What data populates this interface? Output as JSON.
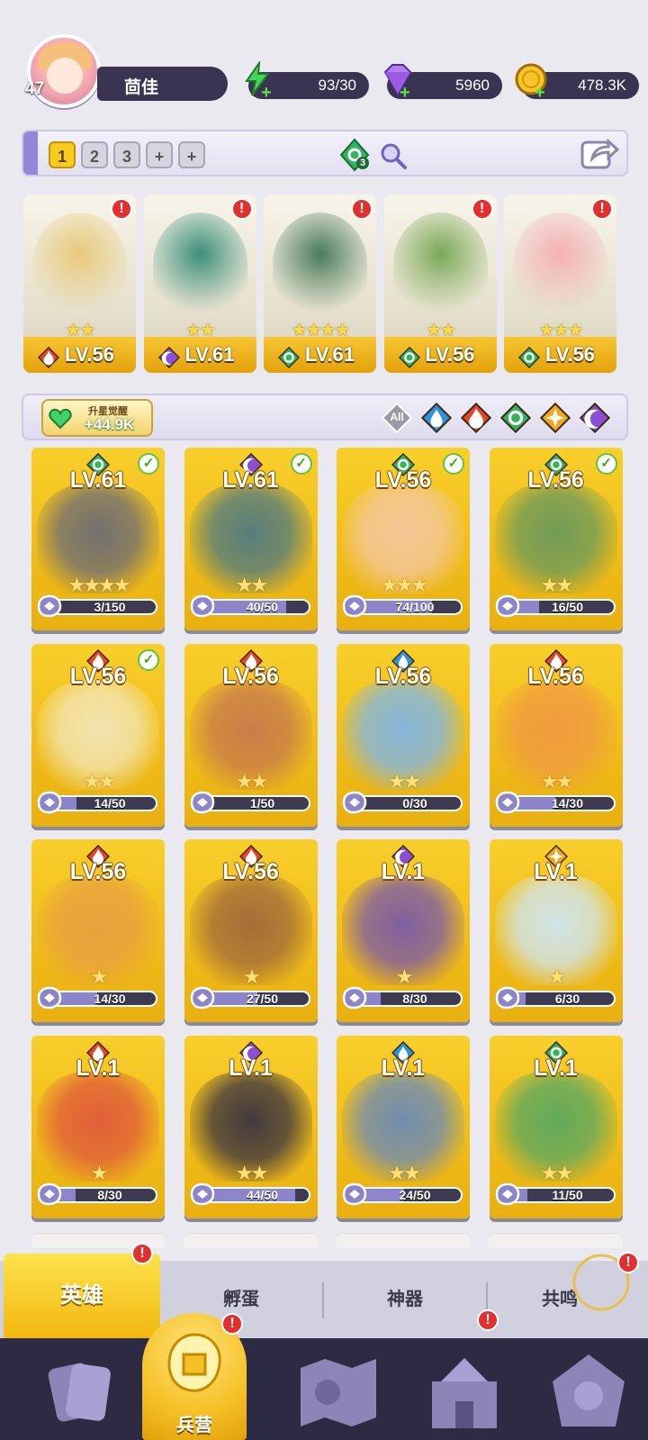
{
  "player": {
    "level": "47",
    "name": "茴佳"
  },
  "resources": {
    "energy": "93/30",
    "gems": "5960",
    "gold": "478.3K"
  },
  "team_bar": {
    "slots": [
      "1",
      "2",
      "3",
      "+",
      "+"
    ],
    "active_slot": "1",
    "badge_count": "3"
  },
  "team": [
    {
      "level": "LV.56",
      "element": "fire",
      "stars": "★★"
    },
    {
      "level": "LV.61",
      "element": "dark",
      "stars": "★★"
    },
    {
      "level": "LV.61",
      "element": "wind",
      "stars": "★★★★"
    },
    {
      "level": "LV.56",
      "element": "wind",
      "stars": "★★"
    },
    {
      "level": "LV.56",
      "element": "wind",
      "stars": "★★★"
    }
  ],
  "awaken": {
    "label": "升星觉醒",
    "value": "+44.9K"
  },
  "filters": {
    "all_label": "All",
    "elements": [
      "water",
      "fire",
      "wind",
      "light",
      "dark"
    ]
  },
  "heroes": [
    {
      "level": "LV.61",
      "element": "wind",
      "stars": "★★★★",
      "progress": "3/150",
      "fraction": 0.02,
      "checked": true
    },
    {
      "level": "LV.61",
      "element": "dark",
      "stars": "★★",
      "progress": "40/50",
      "fraction": 0.8,
      "checked": true
    },
    {
      "level": "LV.56",
      "element": "wind",
      "stars": "★★★",
      "progress": "74/100",
      "fraction": 0.74,
      "checked": true
    },
    {
      "level": "LV.56",
      "element": "wind",
      "stars": "★★",
      "progress": "16/50",
      "fraction": 0.32,
      "checked": true
    },
    {
      "level": "LV.56",
      "element": "fire",
      "stars": "★★",
      "progress": "14/50",
      "fraction": 0.28,
      "checked": true
    },
    {
      "level": "LV.56",
      "element": "fire",
      "stars": "★★",
      "progress": "1/50",
      "fraction": 0.02,
      "checked": false
    },
    {
      "level": "LV.56",
      "element": "water",
      "stars": "★★",
      "progress": "0/30",
      "fraction": 0.0,
      "checked": false
    },
    {
      "level": "LV.56",
      "element": "fire",
      "stars": "★★",
      "progress": "14/30",
      "fraction": 0.47,
      "checked": false
    },
    {
      "level": "LV.56",
      "element": "fire",
      "stars": "★",
      "progress": "14/30",
      "fraction": 0.47,
      "checked": false
    },
    {
      "level": "LV.56",
      "element": "fire",
      "stars": "★",
      "progress": "27/50",
      "fraction": 0.54,
      "checked": false
    },
    {
      "level": "LV.1",
      "element": "dark",
      "stars": "★",
      "progress": "8/30",
      "fraction": 0.27,
      "checked": false
    },
    {
      "level": "LV.1",
      "element": "light",
      "stars": "★",
      "progress": "6/30",
      "fraction": 0.2,
      "checked": false
    },
    {
      "level": "LV.1",
      "element": "fire",
      "stars": "★",
      "progress": "8/30",
      "fraction": 0.27,
      "checked": false
    },
    {
      "level": "LV.1",
      "element": "dark",
      "stars": "★★",
      "progress": "44/50",
      "fraction": 0.88,
      "checked": false
    },
    {
      "level": "LV.1",
      "element": "water",
      "stars": "★★",
      "progress": "24/50",
      "fraction": 0.48,
      "checked": false
    },
    {
      "level": "LV.1",
      "element": "wind",
      "stars": "★★",
      "progress": "11/50",
      "fraction": 0.22,
      "checked": false
    }
  ],
  "tabs": {
    "heroes": "英雄",
    "hatch": "孵蛋",
    "artifacts": "神器",
    "resonance": "共鸣"
  },
  "nav": {
    "barracks": "兵营"
  },
  "colors": {
    "fire": "#e8422a",
    "dark": "#8b4fd6",
    "wind": "#2fb65c",
    "water": "#2f8fe0",
    "light": "#f0a81c",
    "card_gold": "#f2c01c",
    "nav_bg": "#2d2a43",
    "plate_bg": "#3a3352"
  }
}
